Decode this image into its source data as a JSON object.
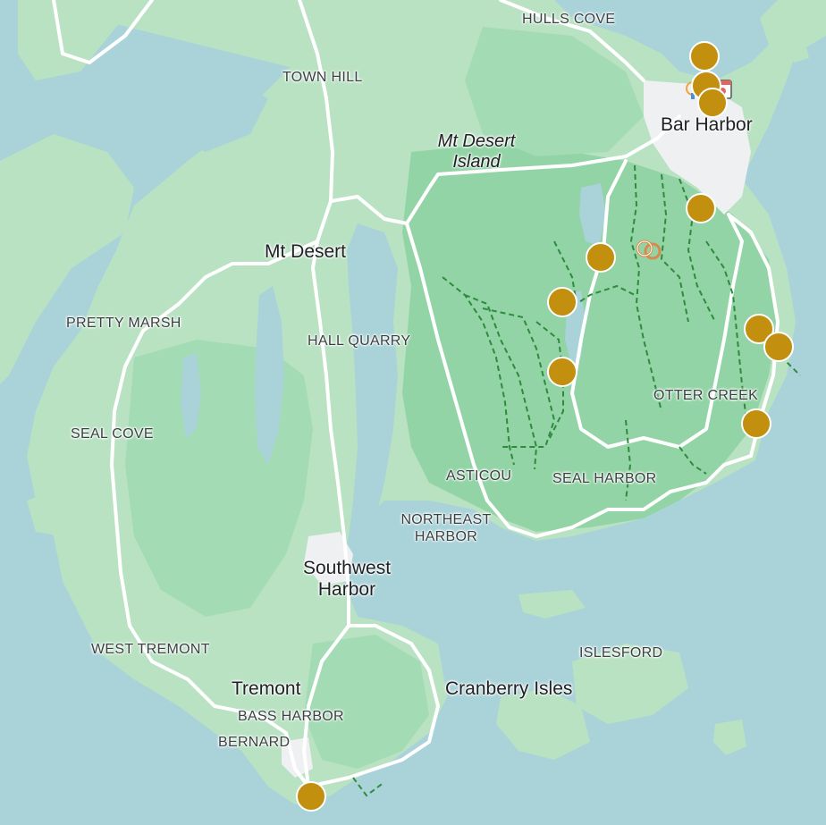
{
  "map": {
    "colors": {
      "water": "#aad3d9",
      "land": "#b9e2c3",
      "park": "#92d4a6",
      "road": "#ffffff",
      "urban": "#eef0f2",
      "trail": "#2e8b3d",
      "marker": "#c28f0e"
    },
    "labels": {
      "hulls_cove": "HULLS COVE",
      "town_hill": "TOWN HILL",
      "bar_harbor": "Bar Harbor",
      "mt_desert_island": "Mt Desert\nIsland",
      "mt_desert": "Mt Desert",
      "pretty_marsh": "PRETTY MARSH",
      "hall_quarry": "HALL QUARRY",
      "otter_creek": "OTTER CREEK",
      "seal_cove": "SEAL COVE",
      "asticou": "ASTICOU",
      "seal_harbor": "SEAL HARBOR",
      "northeast_harbor": "NORTHEAST\nHARBOR",
      "southwest_harbor": "Southwest\nHarbor",
      "west_tremont": "WEST TREMONT",
      "islesford": "ISLESFORD",
      "tremont": "Tremont",
      "cranberry_isles": "Cranberry Isles",
      "bass_harbor": "BASS HARBOR",
      "bernard": "BERNARD"
    },
    "markers_count": 12,
    "poi_icons": [
      "ferris-wheel-poi-icon",
      "calendar-poi-icon",
      "rings-poi-icon"
    ]
  }
}
